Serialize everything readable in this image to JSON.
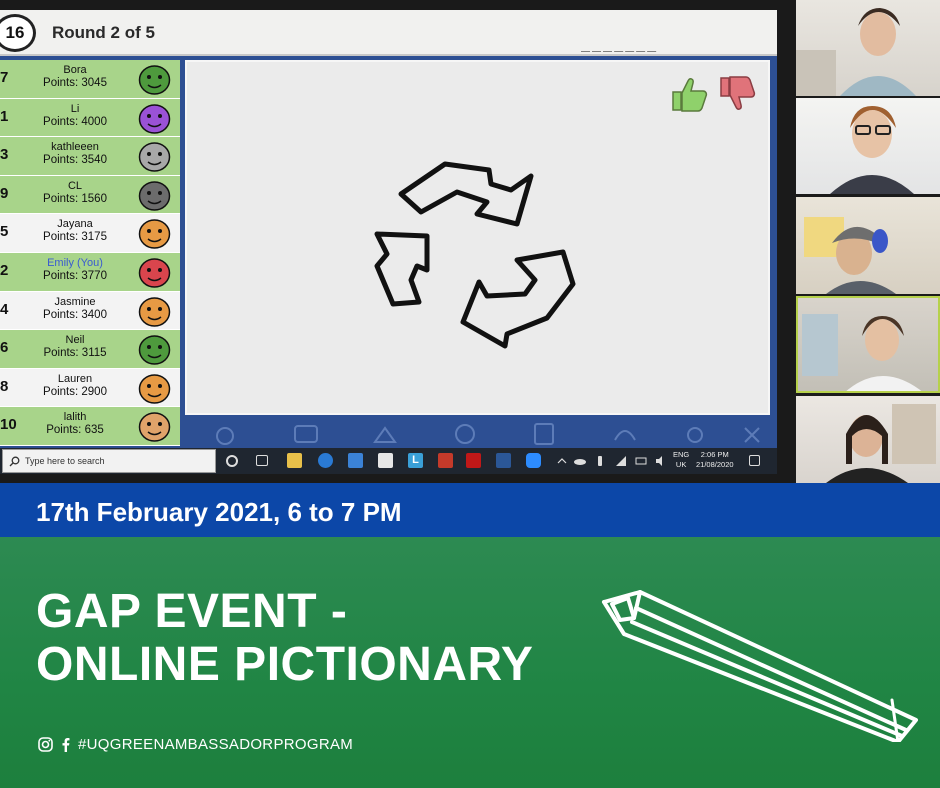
{
  "game": {
    "timer": "16",
    "round_label": "Round 2 of 5",
    "word_hint": "_______",
    "players": [
      {
        "rank": "7",
        "name": "Bora",
        "points": "Points: 3045",
        "face": "#4e9a3d",
        "row": "g",
        "you": false
      },
      {
        "rank": "1",
        "name": "Li",
        "points": "Points: 4000",
        "face": "#9a52d6",
        "row": "g",
        "you": false
      },
      {
        "rank": "3",
        "name": "kathleeen",
        "points": "Points: 3540",
        "face": "#a8a8a8",
        "row": "g",
        "you": false
      },
      {
        "rank": "9",
        "name": "CL",
        "points": "Points: 1560",
        "face": "#6c6c6c",
        "row": "g",
        "you": false
      },
      {
        "rank": "5",
        "name": "Jayana",
        "points": "Points: 3175",
        "face": "#e79a44",
        "row": "w",
        "you": false
      },
      {
        "rank": "2",
        "name": "Emily (You)",
        "points": "Points: 3770",
        "face": "#d9454d",
        "row": "g",
        "you": true
      },
      {
        "rank": "4",
        "name": "Jasmine",
        "points": "Points: 3400",
        "face": "#e79a44",
        "row": "w",
        "you": false
      },
      {
        "rank": "6",
        "name": "Neil",
        "points": "Points: 3115",
        "face": "#4e9a3d",
        "row": "g",
        "you": false
      },
      {
        "rank": "8",
        "name": "Lauren",
        "points": "Points: 2900",
        "face": "#e79a44",
        "row": "w",
        "you": false
      },
      {
        "rank": "10",
        "name": "lalith",
        "points": "Points: 635",
        "face": "#e0a36a",
        "row": "g",
        "you": false
      }
    ],
    "like_color": "#8fd16b",
    "dislike_color": "#e0737a"
  },
  "taskbar": {
    "search_placeholder": "Type here to search",
    "lang_top": "ENG",
    "lang_bottom": "UK",
    "time": "2:06 PM",
    "date": "21/08/2020"
  },
  "banner": {
    "date_line": "17th February 2021, 6 to 7 PM",
    "title_line1": "GAP EVENT -",
    "title_line2": "ONLINE PICTIONARY",
    "hashtag": "#UQGREENAMBASSADORPROGRAM",
    "icons": [
      "instagram-icon",
      "facebook-icon",
      "pencil-illustration"
    ]
  },
  "colors": {
    "blue_bar": "#0c47a8",
    "green_panel": "#208544",
    "game_frame": "#2d4f93"
  }
}
